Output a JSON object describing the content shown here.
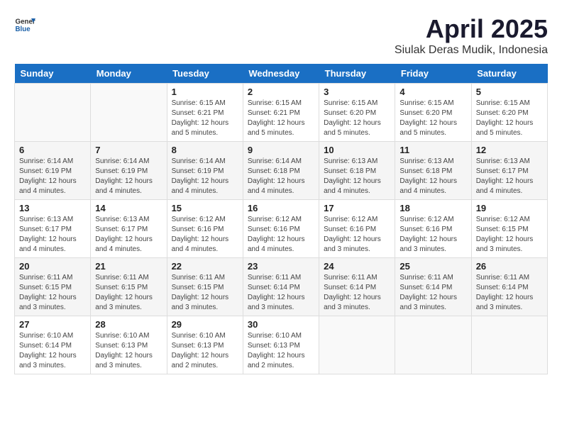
{
  "header": {
    "logo_general": "General",
    "logo_blue": "Blue",
    "month_title": "April 2025",
    "subtitle": "Siulak Deras Mudik, Indonesia"
  },
  "weekdays": [
    "Sunday",
    "Monday",
    "Tuesday",
    "Wednesday",
    "Thursday",
    "Friday",
    "Saturday"
  ],
  "weeks": [
    [
      {
        "day": "",
        "info": ""
      },
      {
        "day": "",
        "info": ""
      },
      {
        "day": "1",
        "info": "Sunrise: 6:15 AM\nSunset: 6:21 PM\nDaylight: 12 hours\nand 5 minutes."
      },
      {
        "day": "2",
        "info": "Sunrise: 6:15 AM\nSunset: 6:21 PM\nDaylight: 12 hours\nand 5 minutes."
      },
      {
        "day": "3",
        "info": "Sunrise: 6:15 AM\nSunset: 6:20 PM\nDaylight: 12 hours\nand 5 minutes."
      },
      {
        "day": "4",
        "info": "Sunrise: 6:15 AM\nSunset: 6:20 PM\nDaylight: 12 hours\nand 5 minutes."
      },
      {
        "day": "5",
        "info": "Sunrise: 6:15 AM\nSunset: 6:20 PM\nDaylight: 12 hours\nand 5 minutes."
      }
    ],
    [
      {
        "day": "6",
        "info": "Sunrise: 6:14 AM\nSunset: 6:19 PM\nDaylight: 12 hours\nand 4 minutes."
      },
      {
        "day": "7",
        "info": "Sunrise: 6:14 AM\nSunset: 6:19 PM\nDaylight: 12 hours\nand 4 minutes."
      },
      {
        "day": "8",
        "info": "Sunrise: 6:14 AM\nSunset: 6:19 PM\nDaylight: 12 hours\nand 4 minutes."
      },
      {
        "day": "9",
        "info": "Sunrise: 6:14 AM\nSunset: 6:18 PM\nDaylight: 12 hours\nand 4 minutes."
      },
      {
        "day": "10",
        "info": "Sunrise: 6:13 AM\nSunset: 6:18 PM\nDaylight: 12 hours\nand 4 minutes."
      },
      {
        "day": "11",
        "info": "Sunrise: 6:13 AM\nSunset: 6:18 PM\nDaylight: 12 hours\nand 4 minutes."
      },
      {
        "day": "12",
        "info": "Sunrise: 6:13 AM\nSunset: 6:17 PM\nDaylight: 12 hours\nand 4 minutes."
      }
    ],
    [
      {
        "day": "13",
        "info": "Sunrise: 6:13 AM\nSunset: 6:17 PM\nDaylight: 12 hours\nand 4 minutes."
      },
      {
        "day": "14",
        "info": "Sunrise: 6:13 AM\nSunset: 6:17 PM\nDaylight: 12 hours\nand 4 minutes."
      },
      {
        "day": "15",
        "info": "Sunrise: 6:12 AM\nSunset: 6:16 PM\nDaylight: 12 hours\nand 4 minutes."
      },
      {
        "day": "16",
        "info": "Sunrise: 6:12 AM\nSunset: 6:16 PM\nDaylight: 12 hours\nand 4 minutes."
      },
      {
        "day": "17",
        "info": "Sunrise: 6:12 AM\nSunset: 6:16 PM\nDaylight: 12 hours\nand 3 minutes."
      },
      {
        "day": "18",
        "info": "Sunrise: 6:12 AM\nSunset: 6:16 PM\nDaylight: 12 hours\nand 3 minutes."
      },
      {
        "day": "19",
        "info": "Sunrise: 6:12 AM\nSunset: 6:15 PM\nDaylight: 12 hours\nand 3 minutes."
      }
    ],
    [
      {
        "day": "20",
        "info": "Sunrise: 6:11 AM\nSunset: 6:15 PM\nDaylight: 12 hours\nand 3 minutes."
      },
      {
        "day": "21",
        "info": "Sunrise: 6:11 AM\nSunset: 6:15 PM\nDaylight: 12 hours\nand 3 minutes."
      },
      {
        "day": "22",
        "info": "Sunrise: 6:11 AM\nSunset: 6:15 PM\nDaylight: 12 hours\nand 3 minutes."
      },
      {
        "day": "23",
        "info": "Sunrise: 6:11 AM\nSunset: 6:14 PM\nDaylight: 12 hours\nand 3 minutes."
      },
      {
        "day": "24",
        "info": "Sunrise: 6:11 AM\nSunset: 6:14 PM\nDaylight: 12 hours\nand 3 minutes."
      },
      {
        "day": "25",
        "info": "Sunrise: 6:11 AM\nSunset: 6:14 PM\nDaylight: 12 hours\nand 3 minutes."
      },
      {
        "day": "26",
        "info": "Sunrise: 6:11 AM\nSunset: 6:14 PM\nDaylight: 12 hours\nand 3 minutes."
      }
    ],
    [
      {
        "day": "27",
        "info": "Sunrise: 6:10 AM\nSunset: 6:14 PM\nDaylight: 12 hours\nand 3 minutes."
      },
      {
        "day": "28",
        "info": "Sunrise: 6:10 AM\nSunset: 6:13 PM\nDaylight: 12 hours\nand 3 minutes."
      },
      {
        "day": "29",
        "info": "Sunrise: 6:10 AM\nSunset: 6:13 PM\nDaylight: 12 hours\nand 2 minutes."
      },
      {
        "day": "30",
        "info": "Sunrise: 6:10 AM\nSunset: 6:13 PM\nDaylight: 12 hours\nand 2 minutes."
      },
      {
        "day": "",
        "info": ""
      },
      {
        "day": "",
        "info": ""
      },
      {
        "day": "",
        "info": ""
      }
    ]
  ]
}
